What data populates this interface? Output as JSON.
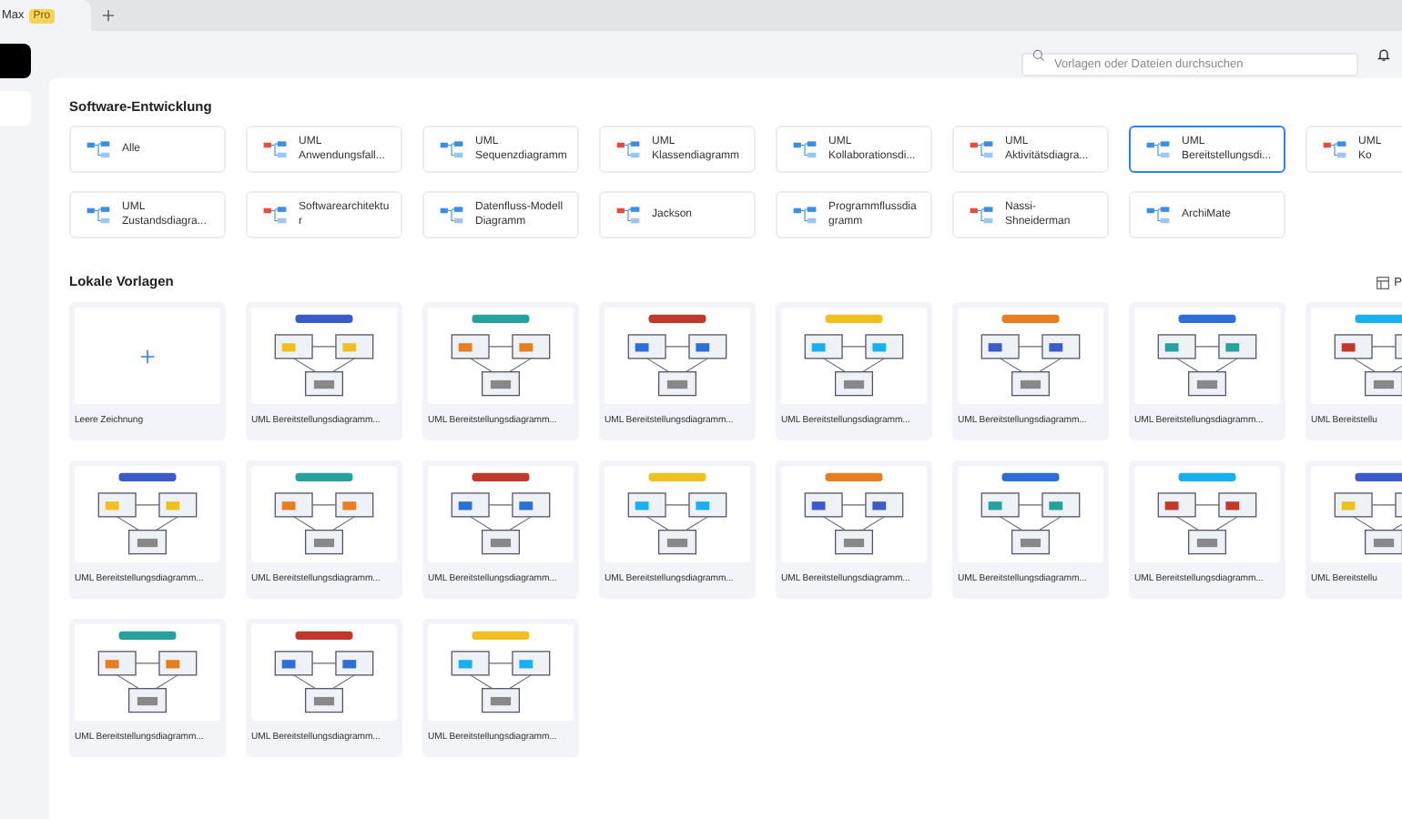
{
  "app_tab": {
    "title": "Max",
    "badge": "Pro"
  },
  "search": {
    "placeholder": "Vorlagen oder Dateien durchsuchen"
  },
  "section_title": "Software-Entwicklung",
  "categories": [
    {
      "label": "Alle",
      "selected": false
    },
    {
      "label": "UML\nAnwendungsfall...",
      "selected": false
    },
    {
      "label": "UML\nSequenzdiagramm",
      "selected": false
    },
    {
      "label": "UML\nKlassendiagramm",
      "selected": false
    },
    {
      "label": "UML\nKollaborationsdi...",
      "selected": false
    },
    {
      "label": "UML\nAktivitätsdiagra...",
      "selected": false
    },
    {
      "label": "UML\nBereitstellungsdi...",
      "selected": true
    },
    {
      "label": "UML\nKo",
      "selected": false
    },
    {
      "label": "UML\nZustandsdiagra...",
      "selected": false
    },
    {
      "label": "Softwarearchitektu\nr",
      "selected": false
    },
    {
      "label": "Datenfluss-Modell\nDiagramm",
      "selected": false
    },
    {
      "label": "Jackson",
      "selected": false
    },
    {
      "label": "Programmflussdia\ngramm",
      "selected": false
    },
    {
      "label": "Nassi-\nShneiderman",
      "selected": false
    },
    {
      "label": "ArchiMate",
      "selected": false
    }
  ],
  "local_title": "Lokale Vorlagen",
  "layout_button": "P",
  "templates": [
    {
      "kind": "blank",
      "caption": "Leere Zeichnung"
    },
    {
      "kind": "diagram",
      "caption": "UML Bereitstellungsdiagramm..."
    },
    {
      "kind": "diagram",
      "caption": "UML Bereitstellungsdiagramm..."
    },
    {
      "kind": "diagram",
      "caption": "UML Bereitstellungsdiagramm..."
    },
    {
      "kind": "diagram",
      "caption": "UML Bereitstellungsdiagramm..."
    },
    {
      "kind": "diagram",
      "caption": "UML Bereitstellungsdiagramm..."
    },
    {
      "kind": "diagram",
      "caption": "UML Bereitstellungsdiagramm..."
    },
    {
      "kind": "diagram",
      "caption": "UML Bereitstellu"
    },
    {
      "kind": "diagram",
      "caption": "UML Bereitstellungsdiagramm..."
    },
    {
      "kind": "diagram",
      "caption": "UML Bereitstellungsdiagramm..."
    },
    {
      "kind": "diagram",
      "caption": "UML Bereitstellungsdiagramm..."
    },
    {
      "kind": "diagram",
      "caption": "UML Bereitstellungsdiagramm..."
    },
    {
      "kind": "diagram",
      "caption": "UML Bereitstellungsdiagramm..."
    },
    {
      "kind": "diagram",
      "caption": "UML Bereitstellungsdiagramm..."
    },
    {
      "kind": "diagram",
      "caption": "UML Bereitstellungsdiagramm..."
    },
    {
      "kind": "diagram",
      "caption": "UML Bereitstellu"
    },
    {
      "kind": "diagram",
      "caption": "UML Bereitstellungsdiagramm..."
    },
    {
      "kind": "diagram",
      "caption": "UML Bereitstellungsdiagramm..."
    },
    {
      "kind": "diagram",
      "caption": "UML Bereitstellungsdiagramm..."
    }
  ]
}
